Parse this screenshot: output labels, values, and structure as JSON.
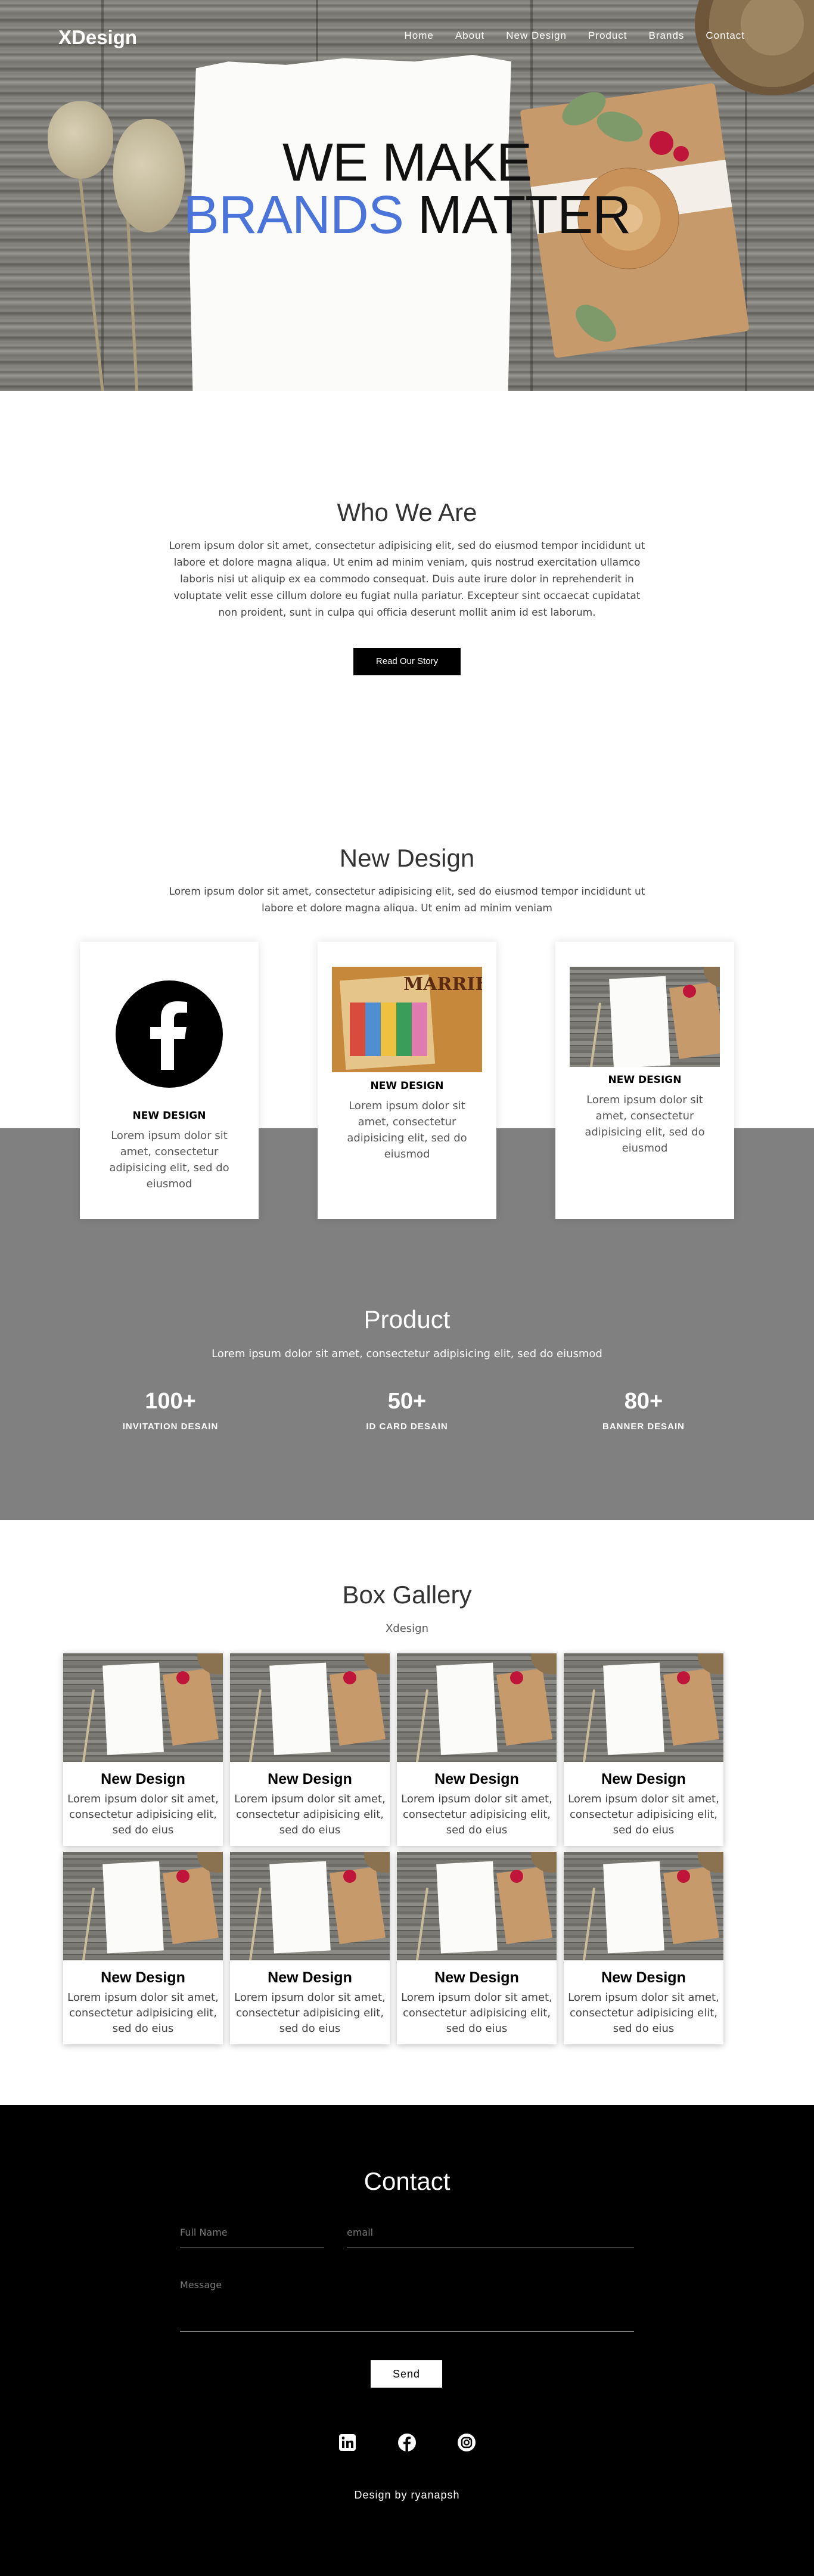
{
  "nav": {
    "logo": "XDesign",
    "links": [
      "Home",
      "About",
      "New Design",
      "Product",
      "Brands",
      "Contact"
    ]
  },
  "hero": {
    "line1": "WE MAKE",
    "line2_accent": "BRANDS",
    "line2_rest": "MATTER"
  },
  "about": {
    "title": "Who We Are",
    "text": "Lorem ipsum dolor sit amet, consectetur adipisicing elit, sed do eiusmod tempor incididunt ut labore et dolore magna aliqua. Ut enim ad minim veniam, quis nostrud exercitation ullamco laboris nisi ut aliquip ex ea commodo consequat. Duis aute irure dolor in reprehenderit in voluptate velit esse cillum dolore eu fugiat nulla pariatur. Excepteur sint occaecat cupidatat non proident, sunt in culpa qui officia deserunt mollit anim id est laborum.",
    "button": "Read Our Story"
  },
  "new_design": {
    "title": "New Design",
    "text": "Lorem ipsum dolor sit amet, consectetur adipisicing elit, sed do eiusmod tempor incididunt ut labore et dolore magna aliqua. Ut enim ad minim veniam",
    "cards": [
      {
        "title": "NEW DESIGN",
        "text": "Lorem ipsum dolor sit amet, consectetur adipisicing elit, sed do eiusmod",
        "icon": "facebook-icon"
      },
      {
        "title": "NEW DESIGN",
        "text": "Lorem ipsum dolor sit amet, consectetur adipisicing elit, sed do eiusmod",
        "image_text": "MARRIED"
      },
      {
        "title": "NEW DESIGN",
        "text": "Lorem ipsum dolor sit amet, consectetur adipisicing elit, sed do eiusmod"
      }
    ]
  },
  "product": {
    "title": "Product",
    "text": "Lorem ipsum dolor sit amet, consectetur adipisicing elit, sed do eiusmod",
    "stats": [
      {
        "number": "100+",
        "label": "INVITATION DESAIN"
      },
      {
        "number": "50+",
        "label": "ID CARD DESAIN"
      },
      {
        "number": "80+",
        "label": "BANNER DESAIN"
      }
    ]
  },
  "gallery": {
    "title": "Box Gallery",
    "subtitle": "Xdesign",
    "items": [
      {
        "title": "New Design",
        "text": "Lorem ipsum dolor sit amet, consectetur adipisicing elit, sed do eius"
      },
      {
        "title": "New Design",
        "text": "Lorem ipsum dolor sit amet, consectetur adipisicing elit, sed do eius"
      },
      {
        "title": "New Design",
        "text": "Lorem ipsum dolor sit amet, consectetur adipisicing elit, sed do eius"
      },
      {
        "title": "New Design",
        "text": "Lorem ipsum dolor sit amet, consectetur adipisicing elit, sed do eius"
      },
      {
        "title": "New Design",
        "text": "Lorem ipsum dolor sit amet, consectetur adipisicing elit, sed do eius"
      },
      {
        "title": "New Design",
        "text": "Lorem ipsum dolor sit amet, consectetur adipisicing elit, sed do eius"
      },
      {
        "title": "New Design",
        "text": "Lorem ipsum dolor sit amet, consectetur adipisicing elit, sed do eius"
      },
      {
        "title": "New Design",
        "text": "Lorem ipsum dolor sit amet, consectetur adipisicing elit, sed do eius"
      }
    ]
  },
  "contact": {
    "title": "Contact",
    "name_placeholder": "Full Name",
    "email_placeholder": "email",
    "message_placeholder": "Message",
    "send": "Send",
    "social": [
      "linkedin-icon",
      "facebook-icon",
      "instagram-icon"
    ],
    "footer": "Design by ryanapsh"
  },
  "colors": {
    "accent": "#4a74d9",
    "grey_band": "#808080",
    "footer_bg": "#000000"
  }
}
